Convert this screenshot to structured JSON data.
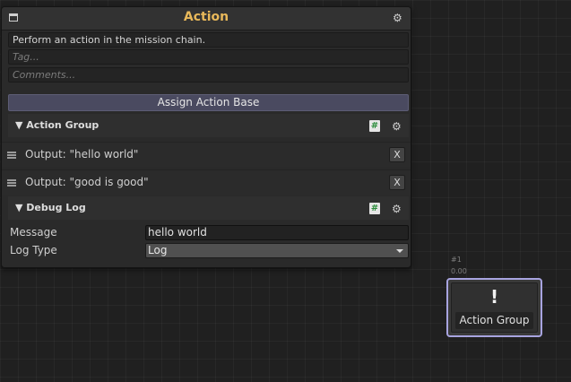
{
  "panel": {
    "title": "Action",
    "description": "Perform an action in the mission chain.",
    "tag_placeholder": "Tag...",
    "comments_placeholder": "Comments...",
    "assign_button": "Assign Action Base"
  },
  "action_group": {
    "title": "▼ Action Group",
    "outputs": [
      {
        "text": "Output: \"hello world\"",
        "remove_label": "X"
      },
      {
        "text": "Output: \"good is good\"",
        "remove_label": "X"
      }
    ]
  },
  "debug_log": {
    "title": "▼ Debug Log",
    "message_label": "Message",
    "message_value": "hello world",
    "log_type_label": "Log Type",
    "log_type_value": "Log"
  },
  "node": {
    "id": "#1",
    "time": "0.00",
    "icon": "!",
    "label": "Action Group",
    "selection_color": "#a8a4e0"
  },
  "icons": {
    "window": "window-icon",
    "settings": "⚙",
    "script": "#"
  },
  "colors": {
    "title": "#e8b85a",
    "assign_button": "#4a4a60",
    "background": "#202020"
  }
}
